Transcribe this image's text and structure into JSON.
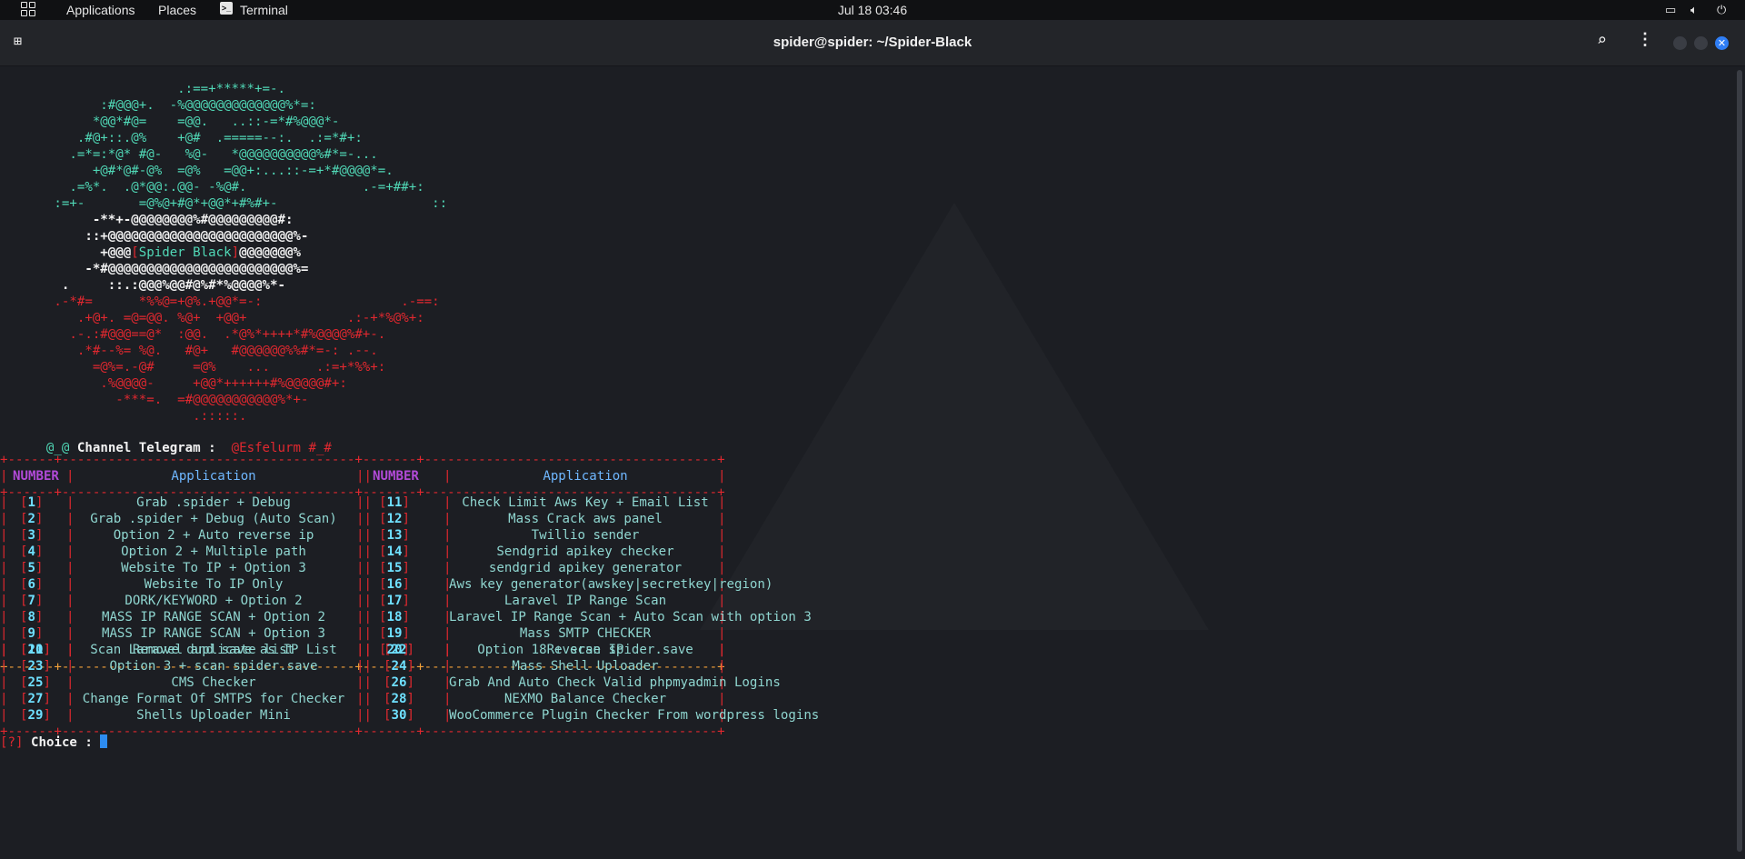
{
  "panel": {
    "applications": "Applications",
    "places": "Places",
    "terminal": "Terminal",
    "clock": "Jul 18  03:46"
  },
  "window": {
    "title": "spider@spider: ~/Spider-Black"
  },
  "banner": {
    "cyan_lines": [
      "                       .:==+*****+=-.",
      "             :#@@@+.  -%@@@@@@@@@@@@@%*=:",
      "            *@@*#@=    =@@.   ..::-=*#%@@@*-",
      "          .#@+::.@%    +@#  .=====--:.  .:=*#+:",
      "         .=*=:*@* #@-   %@-   *@@@@@@@@@@%#*=-...",
      "            +@#*@#-@%  =@%   =@@+:...::-=+*#@@@@*=.",
      "         .=%*.  .@*@@:.@@- -%@#.               .-=+##+:",
      "       :=+-       =@%@+#@*+@@*+#%#+-                    ::"
    ],
    "white_lines": [
      "            -**+-@@@@@@@@%#@@@@@@@@@#:",
      "           ::+@@@@@@@@@@@@@@@@@@@@@@@@%-"
    ],
    "spider_line_pre": "             +@@@",
    "spider_bracket_l": "[",
    "spider_name": "Spider Black",
    "spider_bracket_r": "]",
    "spider_line_post": "@@@@@@@%",
    "white_lines2": [
      "           -*#@@@@@@@@@@@@@@@@@@@@@@@@%=",
      "        .     ::.:@@@%@@#@%#*%@@@@%*-"
    ],
    "red_lines": [
      "       .-*#=      *%%@=+@%.+@@*=-:                  .-==:",
      "          .+@+. =@=@@. %@+  +@@+             .:-+*%@%+:",
      "         .-.:#@@@==@*  :@@.  .*@%*++++*#%@@@@%#+-.",
      "          .*#--%= %@.   #@+   #@@@@@@%%#*=-: .--.",
      "            =@%=.-@#     =@%    ...      .:=+*%%+:",
      "             .%@@@@-     +@@*++++++#%@@@@@#+:",
      "               -***=.  =#@@@@@@@@@@@%*+-",
      "                         .:::::."
    ]
  },
  "channel": {
    "prefix": "@_@",
    "label": "Channel Telegram :",
    "handle": "@Esfelurm #_#"
  },
  "table": {
    "header_number": "NUMBER",
    "header_application": "Application",
    "rows_left": [
      [
        "1",
        "Grab .spider + Debug"
      ],
      [
        "2",
        "Grab .spider + Debug (Auto Scan)"
      ],
      [
        "3",
        "Option 2 + Auto reverse ip"
      ],
      [
        "4",
        "Option 2 + Multiple path"
      ],
      [
        "5",
        "Website To IP + Option 3"
      ],
      [
        "6",
        "Website To IP Only"
      ],
      [
        "7",
        "DORK/KEYWORD + Option 2"
      ],
      [
        "8",
        "MASS IP RANGE SCAN + Option 2"
      ],
      [
        "9",
        "MASS IP RANGE SCAN + Option 3"
      ],
      [
        "10",
        "Remove duplicate list"
      ]
    ],
    "rows_right": [
      [
        "11",
        "Check Limit Aws Key + Email List"
      ],
      [
        "12",
        "Mass Crack aws panel"
      ],
      [
        "13",
        "Twillio sender"
      ],
      [
        "14",
        "Sendgrid apikey checker"
      ],
      [
        "15",
        "sendgrid apikey generator"
      ],
      [
        "16",
        "Aws key generator(awskey|secretkey|region)"
      ],
      [
        "17",
        "Laravel IP Range Scan"
      ],
      [
        "18",
        "Laravel IP Range Scan + Auto Scan with option 3"
      ],
      [
        "19",
        "Mass SMTP CHECKER"
      ],
      [
        "20",
        "Reverse IP"
      ]
    ],
    "rows2_left": [
      [
        "21",
        "Scan Laravel and save as IP List"
      ],
      [
        "23",
        "Option 3 + scan spider.save"
      ],
      [
        "25",
        "CMS Checker"
      ],
      [
        "27",
        "Change Format Of SMTPS for Checker"
      ],
      [
        "29",
        "Shells Uploader Mini"
      ]
    ],
    "rows2_right": [
      [
        "22",
        "Option 18 + scan spider.save"
      ],
      [
        "24",
        "Mass Shell Uploader"
      ],
      [
        "26",
        "Grab And Auto Check Valid phpmyadmin Logins"
      ],
      [
        "28",
        "NEXMO Balance Checker"
      ],
      [
        "30",
        "WooCommerce Plugin Checker From wordpress logins"
      ]
    ]
  },
  "prompt": {
    "mark": "?",
    "label": "Choice :"
  },
  "colors": {
    "accent_cyan": "#50d8b6",
    "red": "#e0282f",
    "purple": "#b24ad8",
    "blue": "#6fb7ff",
    "orange": "#f0a03a"
  }
}
